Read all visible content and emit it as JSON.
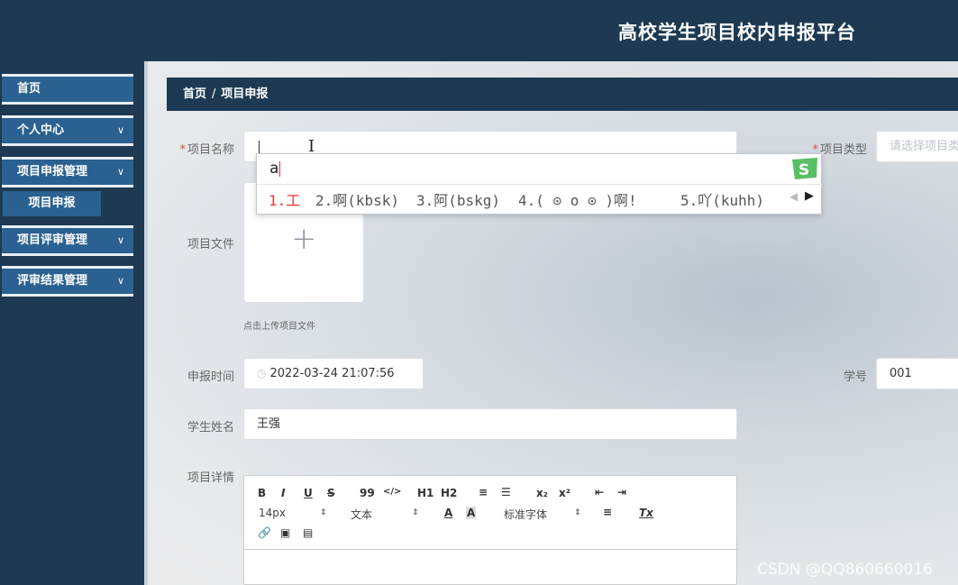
{
  "app": {
    "title": "高校学生项目校内申报平台"
  },
  "sidebar": {
    "items": [
      {
        "label": "首页",
        "has_arrow": false
      },
      {
        "label": "个人中心",
        "has_arrow": true
      },
      {
        "label": "项目申报管理",
        "has_arrow": true
      },
      {
        "label": "项目评审管理",
        "has_arrow": true
      },
      {
        "label": "评审结果管理",
        "has_arrow": true
      }
    ],
    "sub_item": "项目申报",
    "arrow": "chevron-down-icon"
  },
  "breadcrumb": {
    "home": "首页",
    "sep": "/",
    "current": "项目申报"
  },
  "form": {
    "name_label": "项目名称",
    "name_value": "",
    "type_label": "项目类型",
    "type_placeholder": "请选择项目类",
    "file_label": "项目文件",
    "upload_tip": "点击上传项目文件",
    "time_label": "申报时间",
    "time_value": "2022-03-24 21:07:56",
    "student_no_label": "学号",
    "student_no_value": "001",
    "student_name_label": "学生姓名",
    "student_name_value": "王强",
    "detail_label": "项目详情",
    "required_mark": "*"
  },
  "editor": {
    "buttons_row1": [
      "B",
      "I",
      "U",
      "S",
      "99",
      "</>",
      "H1",
      "H2",
      "≡",
      "☰",
      "x₂",
      "x²",
      "⇤",
      "⇥"
    ],
    "font_size": "14px",
    "text_type": "文本",
    "font_family": "标准字体",
    "buttons_row2": [
      "A",
      "A",
      "≡",
      "Tx"
    ],
    "buttons_row3": [
      "link",
      "image",
      "video"
    ]
  },
  "ime": {
    "composition": "a",
    "candidates": [
      "1.工",
      "2.啊(kbsk)",
      "3.阿(bskg)",
      "4.( ⊙ o ⊙ )啊!",
      "5.吖(kuhh)"
    ]
  },
  "watermark": "CSDN @QQ860660016",
  "colors": {
    "navy": "#1d3a52",
    "menu_blue": "#2a6190",
    "required": "#e54d42",
    "ime_red": "#e53935"
  }
}
